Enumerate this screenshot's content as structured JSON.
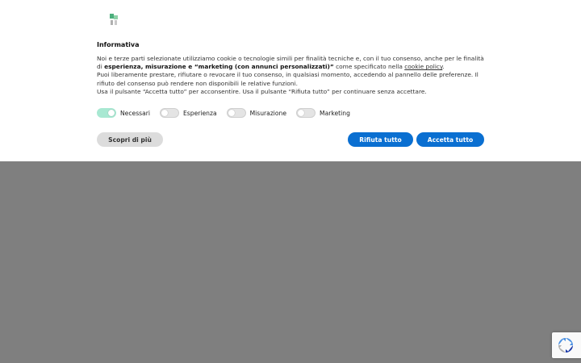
{
  "dialog": {
    "title": "Informativa",
    "paragraph1_part1": "Noi e terze parti selezionate utilizziamo cookie o tecnologie simili per finalità tecniche e, con il tuo consenso, anche per le finalità di ",
    "paragraph1_bold": "esperienza, misurazione e “marketing (con annunci personalizzati)”",
    "paragraph1_part2": " come specificato nella ",
    "cookie_policy_link": "cookie policy",
    "paragraph1_end": ".",
    "paragraph2": "Puoi liberamente prestare, rifiutare o revocare il tuo consenso, in qualsiasi momento, accedendo al pannello delle preferenze. Il rifiuto del consenso può rendere non disponibili le relative funzioni.",
    "paragraph3": "Usa il pulsante “Accetta tutto” per acconsentire. Usa il pulsante “Rifiuta tutto” per continuare senza accettare."
  },
  "toggles": [
    {
      "label": "Necessari",
      "on": true
    },
    {
      "label": "Esperienza",
      "on": false
    },
    {
      "label": "Misurazione",
      "on": false
    },
    {
      "label": "Marketing",
      "on": false
    }
  ],
  "buttons": {
    "learn_more": "Scopri di più",
    "reject_all": "Rifiuta tutto",
    "accept_all": "Accetta tutto"
  },
  "colors": {
    "primary": "#0a6fd1",
    "toggle_on": "#a8e8d2",
    "overlay": "#7f7f7f"
  },
  "icons": {
    "logo": "site-logo",
    "recaptcha": "recaptcha-icon"
  }
}
